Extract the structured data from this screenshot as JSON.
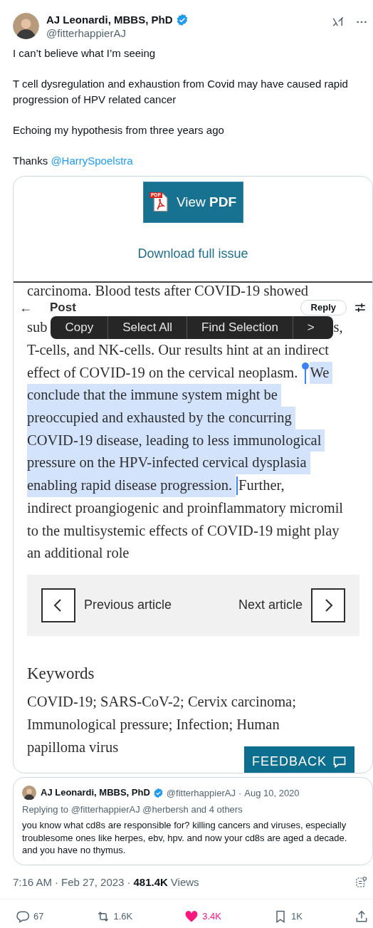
{
  "tweet": {
    "author": {
      "name": "AJ Leonardi, MBBS, PhD",
      "handle": "@fitterhappierAJ",
      "verified": true
    },
    "paragraphs": [
      {
        "text": "I can’t believe what I’m seeing"
      },
      {
        "text": "T cell dysregulation and exhaustion from Covid may have caused rapid progression of HPV related cancer"
      },
      {
        "text": "Echoing my hypothesis from three years ago"
      },
      {
        "text": "Thanks",
        "mention": "@HarrySpoelstra"
      }
    ]
  },
  "attachment": {
    "pdf_button": {
      "label_plain": "View",
      "label_bold": "PDF",
      "badge": "PDF"
    },
    "download_link": "Download full issue",
    "lines": [
      {
        "segments": [
          {
            "text": "carcinoma. Blood tests after COVID-19 showed",
            "selected": false
          }
        ]
      },
      {
        "segments": [
          {
            "text": "sub",
            "selected": false
          },
          {
            "text": "s,",
            "selected": false
          }
        ]
      },
      {
        "segments": [
          {
            "text": "T-cells, and NK-cells. Our results hint at an indirect",
            "selected": false
          }
        ]
      },
      {
        "segments": [
          {
            "text": "effect of COVID-19 on the cervical neoplasm.",
            "selected": false
          },
          {
            "text": "We",
            "selected": true
          }
        ]
      },
      {
        "segments": [
          {
            "text": "conclude that the immune system might be",
            "selected": true
          }
        ]
      },
      {
        "segments": [
          {
            "text": "preoccupied and exhausted by the concurring",
            "selected": true
          }
        ]
      },
      {
        "segments": [
          {
            "text": "COVID-19 disease, leading to less immunological",
            "selected": true
          }
        ]
      },
      {
        "segments": [
          {
            "text": "pressure on the HPV-infected cervical dysplasia",
            "selected": true
          }
        ]
      },
      {
        "segments": [
          {
            "text": "enabling rapid disease progression.",
            "selected": true
          },
          {
            "text": "Further,",
            "selected": false
          }
        ]
      },
      {
        "segments": [
          {
            "text": "indirect proangiogenic and proinflammatory micromil",
            "selected": false
          }
        ]
      },
      {
        "segments": [
          {
            "text": "to the multisystemic effects of COVID-19 might play",
            "selected": false
          }
        ]
      },
      {
        "segments": [
          {
            "text": "an additional role",
            "selected": false
          }
        ]
      }
    ],
    "context_menu": {
      "items": [
        "Copy",
        "Select All",
        "Find Selection"
      ],
      "more": ">"
    },
    "app_header": {
      "back": "←",
      "title": "Post",
      "reply": "Reply"
    },
    "nav": {
      "previous": "Previous article",
      "next": "Next article"
    },
    "keywords": {
      "heading": "Keywords",
      "lines": [
        "COVID-19; SARS-CoV-2; Cervix carcinoma;",
        "Immunological pressure; Infection; Human",
        "papilloma virus"
      ]
    },
    "feedback": "FEEDBACK"
  },
  "quoted": {
    "name": "AJ Leonardi, MBBS, PhD",
    "verified": true,
    "handle": "@fitterhappierAJ",
    "separator": "·",
    "date": "Aug 10, 2020",
    "replying": "Replying to @fitterhappierAJ @herbersh and 4 others",
    "text": "you know what cd8s are responsible for? killing cancers and viruses, especially troublesome ones like herpes, ebv, hpv. and now your cd8s are aged a decade. and you have no thymus."
  },
  "meta": {
    "time": "7:16 AM",
    "separator": "·",
    "date": "Feb 27, 2023",
    "views": "481.4K",
    "views_label": "Views"
  },
  "actions": [
    {
      "kind": "reply",
      "count": "67"
    },
    {
      "kind": "repost",
      "count": "1.6K"
    },
    {
      "kind": "like",
      "count": "3.4K",
      "on": true
    },
    {
      "kind": "bookmark",
      "count": "1K",
      "on": false
    },
    {
      "kind": "share"
    }
  ]
}
